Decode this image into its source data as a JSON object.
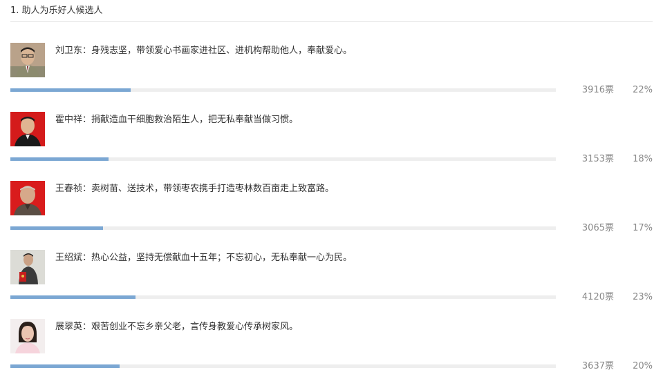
{
  "section": {
    "title": "1. 助人为乐好人候选人"
  },
  "colors": {
    "bar_fill": "#7ba7d3",
    "bar_track": "#eeeeee",
    "muted_text": "#888888"
  },
  "candidates": [
    {
      "description": "刘卫东：身残志坚，带领爱心书画家进社区、进机构帮助他人，奉献爱心。",
      "votes": "3916票",
      "percent_label": "22%",
      "share": 0.22,
      "photo_icon": "man-portrait-icon"
    },
    {
      "description": "霍中祥：捐献造血干细胞救治陌生人，把无私奉献当做习惯。",
      "votes": "3153票",
      "percent_label": "18%",
      "share": 0.18,
      "photo_icon": "man-portrait-icon"
    },
    {
      "description": "王春祯：卖树苗、送技术，带领枣农携手打造枣林数百亩走上致富路。",
      "votes": "3065票",
      "percent_label": "17%",
      "share": 0.17,
      "photo_icon": "man-portrait-icon"
    },
    {
      "description": "王绍斌：热心公益，坚持无偿献血十五年；不忘初心，无私奉献一心为民。",
      "votes": "4120票",
      "percent_label": "23%",
      "share": 0.23,
      "photo_icon": "man-portrait-icon"
    },
    {
      "description": "展翠英：艰苦创业不忘乡亲父老，言传身教爱心传承树家风。",
      "votes": "3637票",
      "percent_label": "20%",
      "share": 0.2,
      "photo_icon": "woman-portrait-icon"
    }
  ]
}
